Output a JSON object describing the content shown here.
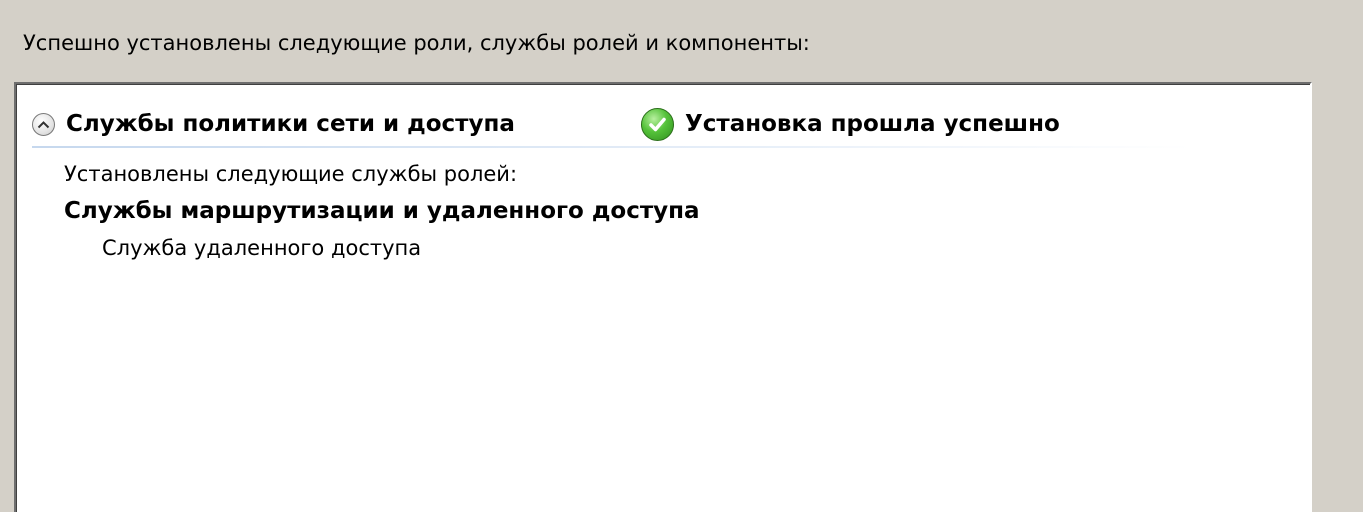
{
  "intro_text": "Успешно установлены следующие роли, службы ролей и компоненты:",
  "role": {
    "name": "Службы политики сети и доступа",
    "status": "Установка прошла успешно",
    "collapse_icon": "chevron-up-icon",
    "status_icon": "success-check-icon",
    "status_color": "#3aa626"
  },
  "details": {
    "caption": "Установлены следующие службы ролей:",
    "group_name": "Службы маршрутизации и удаленного доступа",
    "item": "Служба удаленного доступа"
  }
}
